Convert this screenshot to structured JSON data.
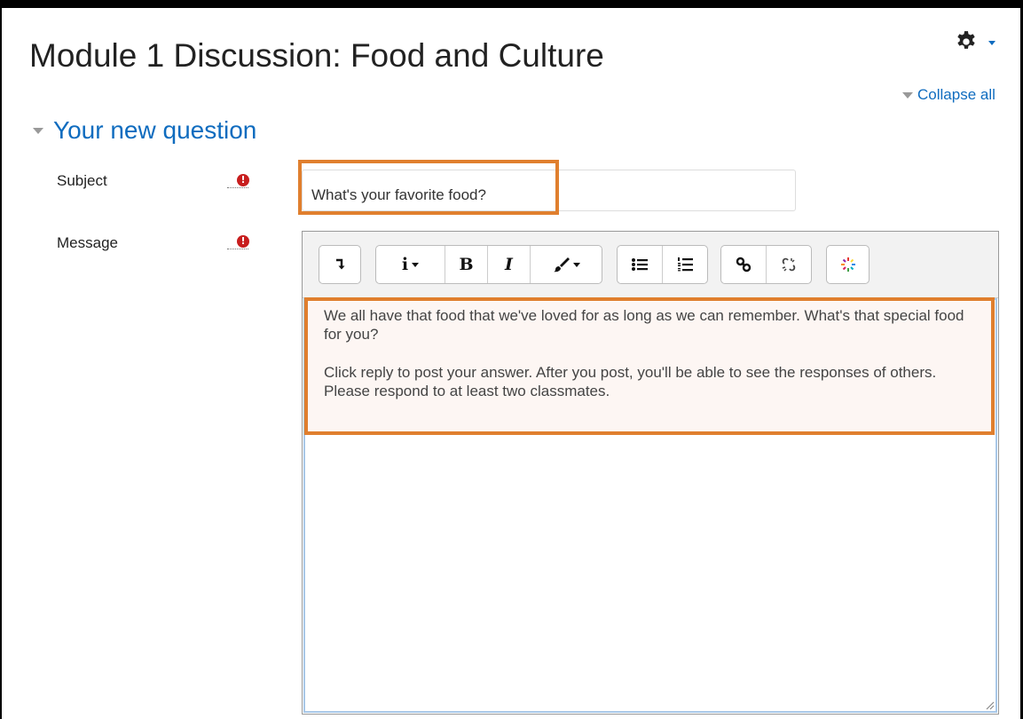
{
  "page": {
    "title": "Module 1 Discussion: Food and Culture",
    "collapse_all": "Collapse all",
    "section_title": "Your new question"
  },
  "form": {
    "subject_label": "Subject",
    "subject_value": "What's your favorite food?",
    "message_label": "Message",
    "required_marker": "!"
  },
  "editor": {
    "toolbar": [
      "show-more-buttons",
      "style",
      "bold",
      "italic",
      "text-color",
      "unordered-list",
      "ordered-list",
      "link",
      "unlink",
      "media-tool"
    ],
    "icons": {
      "bold": "B",
      "italic": "I",
      "style": "i"
    },
    "paragraph1": "We all have that food that we've loved for as long as we can remember. What's that special food for you?",
    "paragraph2": "Click reply to post your answer. After you post, you'll be able to see the responses of others. Please respond to at least two classmates."
  },
  "colors": {
    "link": "#0f6cbf",
    "highlight": "#e07f2e",
    "required": "#c81e1e",
    "content_bg": "#fdf6f3"
  }
}
